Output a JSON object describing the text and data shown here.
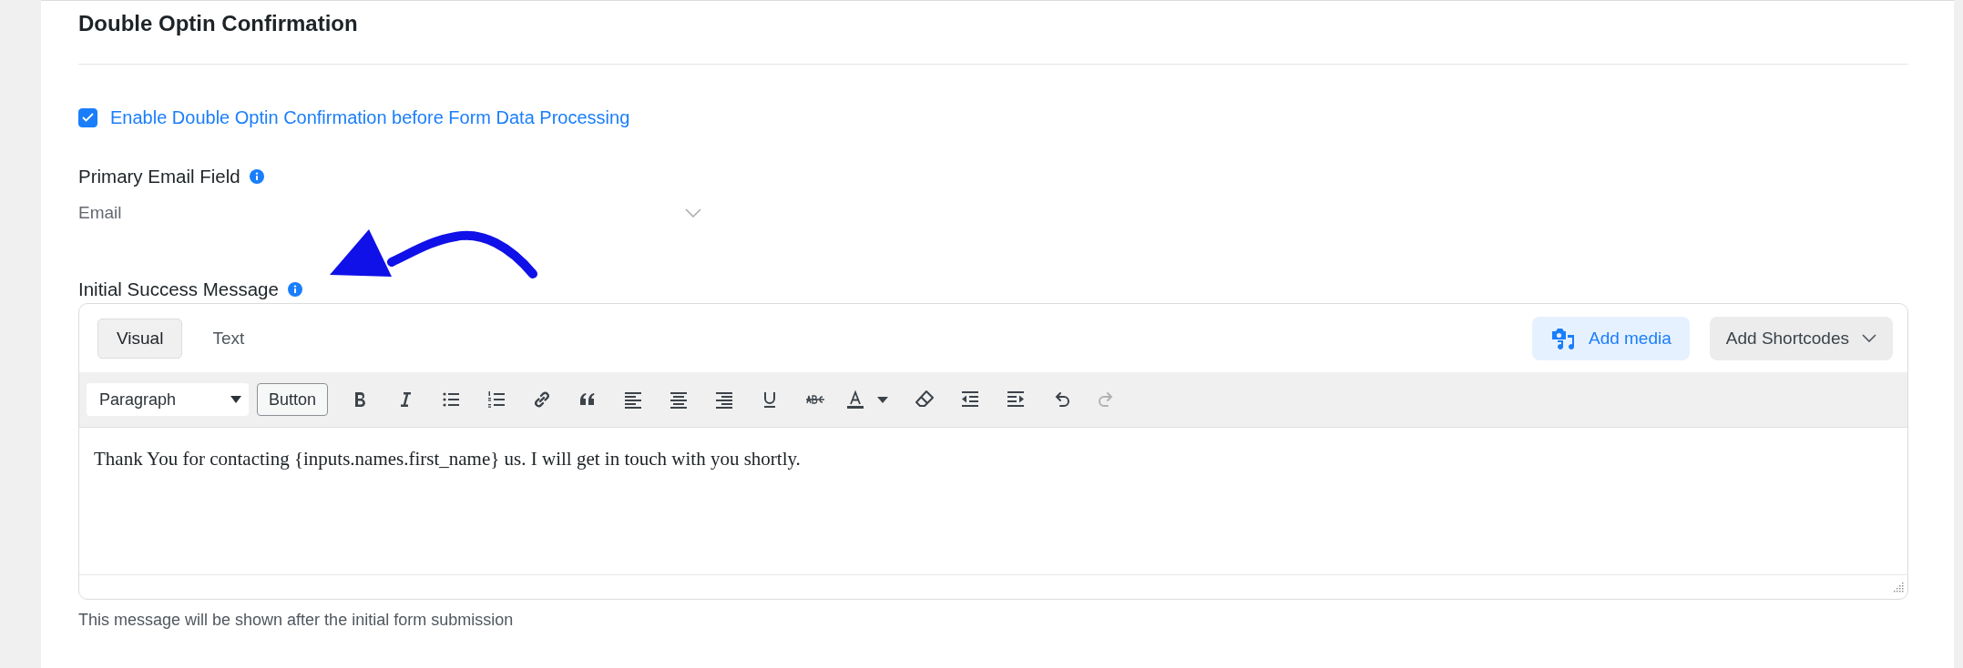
{
  "section": {
    "title": "Double Optin Confirmation"
  },
  "enable_double_optin": {
    "label": "Enable Double Optin Confirmation before Form Data Processing",
    "checked": true
  },
  "primary_email_field": {
    "label": "Primary Email Field",
    "value": "Email"
  },
  "initial_success_message": {
    "label": "Initial Success Message",
    "editor": {
      "tabs": [
        {
          "label": "Visual",
          "selected": true
        },
        {
          "label": "Text",
          "selected": false
        }
      ],
      "add_media": "Add media",
      "add_shortcodes": "Add Shortcodes",
      "format": "Paragraph",
      "button": "Button",
      "tools": [
        {
          "disabled": false
        },
        {
          "disabled": false
        },
        {
          "disabled": false
        },
        {
          "disabled": false
        },
        {
          "disabled": false
        },
        {
          "disabled": false
        },
        {
          "disabled": false
        },
        {
          "disabled": false
        },
        {
          "disabled": false
        },
        {
          "disabled": false
        },
        {
          "disabled": false
        },
        {
          "disabled": false
        },
        {
          "disabled": false
        },
        {
          "disabled": false
        },
        {
          "disabled": false
        },
        {
          "disabled": false
        },
        {
          "disabled": false
        },
        {
          "disabled": true
        }
      ],
      "content": "Thank You for contacting {inputs.names.first_name} us. I will get in touch with you shortly."
    },
    "help": "This message will be shown after the initial form submission"
  }
}
